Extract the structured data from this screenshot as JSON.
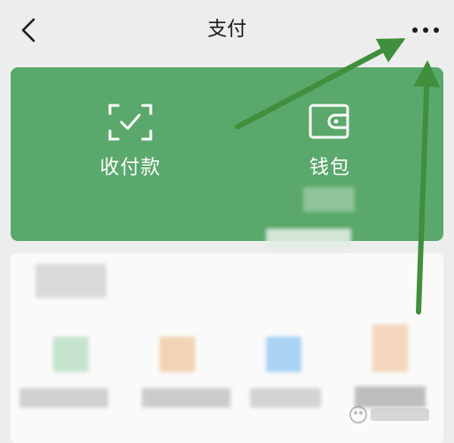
{
  "header": {
    "title": "支付",
    "back_icon": "chevron-left-icon",
    "more_icon": "more-dots-icon"
  },
  "functions": [
    {
      "label": "收付款",
      "icon": "scan-receive-pay-icon"
    },
    {
      "label": "钱包",
      "icon": "wallet-icon"
    }
  ],
  "colors": {
    "accent": "#5aa86b",
    "annotation_arrow": "#3f8f3c",
    "background": "#ededed"
  }
}
